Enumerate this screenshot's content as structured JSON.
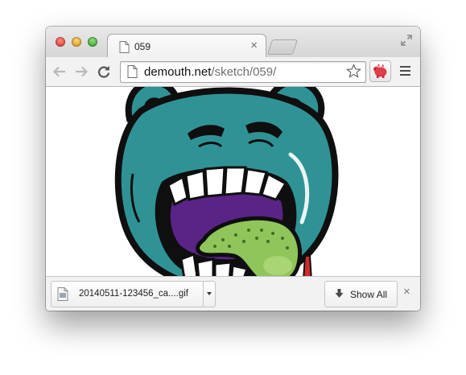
{
  "tab": {
    "title": "059",
    "close_glyph": "×"
  },
  "toolbar": {
    "url_host": "demouth.net",
    "url_path": "/sketch/059/",
    "back_icon": "back-arrow-icon",
    "forward_icon": "forward-arrow-icon",
    "reload_icon": "reload-icon",
    "bookmark_icon": "star-icon",
    "extension_icon": "red-pig-extension-icon",
    "menu_icon": "hamburger-menu-icon"
  },
  "content": {
    "image_subject": "teal monster face with open mouth and green tongue"
  },
  "downloads": {
    "file_name": "20140511-123456_ca....gif",
    "show_all_label": "Show All",
    "close_glyph": "×"
  },
  "colors": {
    "monster_teal": "#2f9396",
    "monster_outline": "#0f0f0f",
    "mouth_purple": "#5a2487",
    "tongue_green": "#8fc55a",
    "extension_red": "#e03e48"
  }
}
